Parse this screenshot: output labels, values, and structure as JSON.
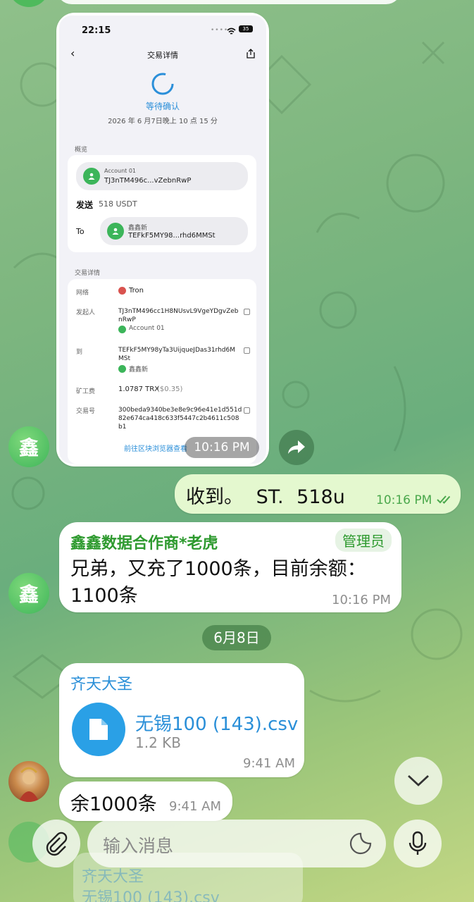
{
  "screenshot": {
    "status_time": "22:15",
    "battery": "35",
    "header_title": "交易详情",
    "state": "等待确认",
    "datetime": "2026 年 6 月7日晚上 10 点 15 分",
    "overview_label": "概览",
    "from_account": "Account 01",
    "from_addr_short": "TJ3nTM496c...vZebnRwP",
    "send_label": "发送",
    "send_amount": "518 USDT",
    "to_label": "To",
    "to_account": "鑫鑫新",
    "to_addr_short": "TEFkF5MY98...rhd6MMSt",
    "details_label": "交易详情",
    "network_label": "网络",
    "network_value": "Tron",
    "initiator_label": "发起人",
    "initiator_addr_1": "TJ3nTM496cc1H8NUsvL9VgeYDgvZeb",
    "initiator_addr_2": "nRwP",
    "initiator_account": "Account 01",
    "to_row_label": "到",
    "to_addr_1": "TEFkF5MY98yTa3UijqueJDas31rhd6M",
    "to_addr_2": "MSt",
    "to_row_account": "鑫鑫新",
    "fee_label": "矿工费",
    "fee_value": "1.0787 TRX",
    "fee_usd": "($0.35)",
    "txid_label": "交易号",
    "txid_1": "300beda9340be3e8e9c96e41e1d551d",
    "txid_2": "82e674ca418c633f5447c2b4611c508",
    "txid_3": "b1",
    "explorer_link": "前往区块浏览器查看"
  },
  "messages": {
    "photo_time": "10:16 PM",
    "out_text": "收到。 ST. 518u",
    "out_time": "10:16 PM",
    "sender1_name": "鑫鑫数据合作商*老虎",
    "sender1_badge": "管理员",
    "sender1_text_1": "兄弟，又充了1000条，目前余额：",
    "sender1_text_2": "1100条",
    "sender1_time": "10:16 PM",
    "date_chip": "6月8日",
    "sender2_name": "齐天大圣",
    "file_name": "无锡100 (143).csv",
    "file_size": "1.2 KB",
    "file_time": "9:41 AM",
    "sender2_text": "余1000条",
    "sender2_time": "9:41 AM",
    "ghost_name": "齐天大圣",
    "ghost_file": "无锡100 (143).csv"
  },
  "avatar_letter": "鑫",
  "input_placeholder": "输入消息",
  "colors": {
    "outgoing_bubble": "#e4f8cf",
    "accent_green": "#2e9a2f",
    "accent_blue": "#2aa0e6",
    "admin_badge_bg": "#e6f3e4"
  }
}
